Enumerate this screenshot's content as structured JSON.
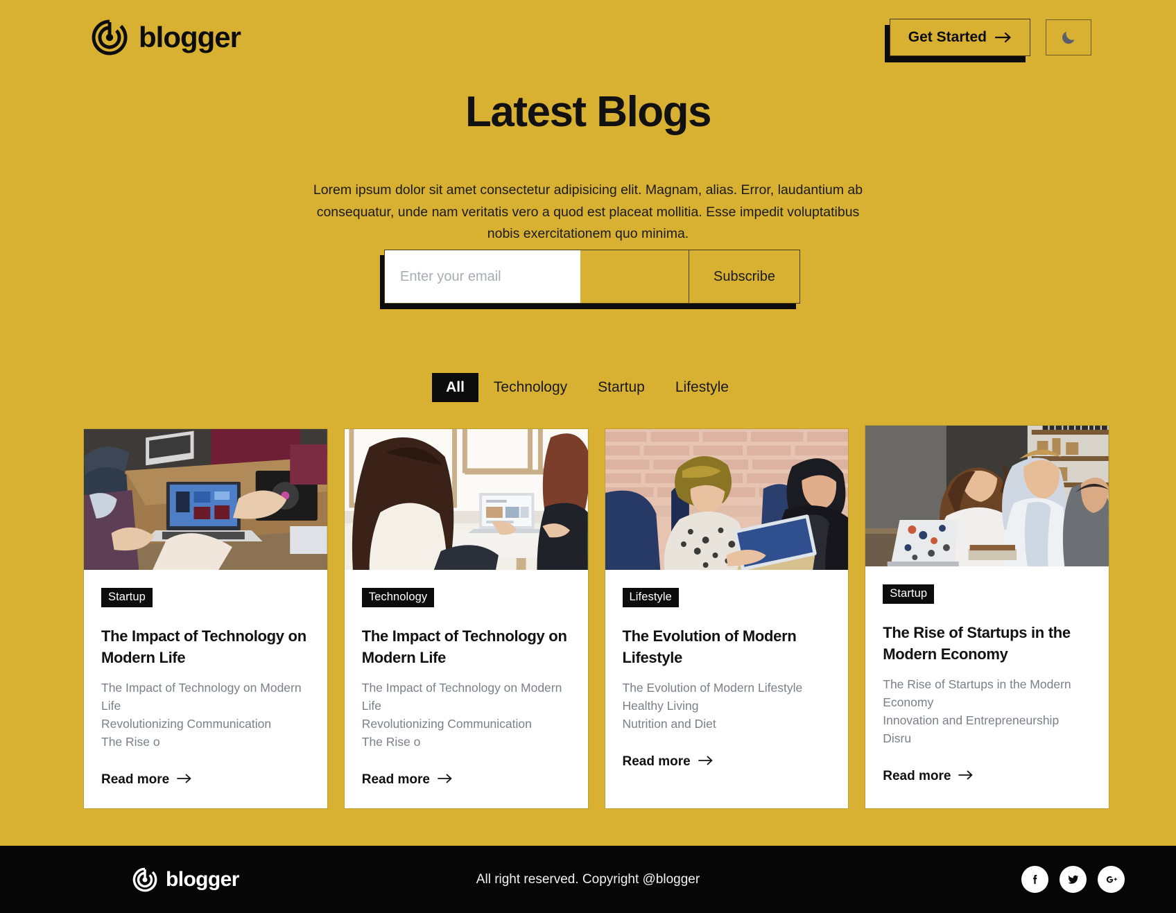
{
  "brand": {
    "name": "blogger",
    "logo_icon": "target-power-icon"
  },
  "header": {
    "get_started_label": "Get Started",
    "get_started_icon": "arrow-right-icon",
    "theme_toggle_icon": "moon-icon"
  },
  "hero": {
    "title": "Latest Blogs",
    "subtitle": "Lorem ipsum dolor sit amet consectetur adipisicing elit. Magnam, alias. Error, laudantium ab consequatur, unde nam veritatis vero a quod est placeat mollitia. Esse impedit voluptatibus nobis exercitationem quo minima."
  },
  "subscribe": {
    "email_placeholder": "Enter your email",
    "email_value": "",
    "button_label": "Subscribe"
  },
  "filters": {
    "items": [
      {
        "label": "All",
        "active": true
      },
      {
        "label": "Technology",
        "active": false
      },
      {
        "label": "Startup",
        "active": false
      },
      {
        "label": "Lifestyle",
        "active": false
      }
    ]
  },
  "cards": [
    {
      "badge": "Startup",
      "title": "The Impact of Technology on Modern Life",
      "excerpt": "The Impact of Technology on Modern Life\nRevolutionizing Communication\nThe Rise o",
      "read_more": "Read more",
      "image_alt": "people-at-desk-with-laptops"
    },
    {
      "badge": "Technology",
      "title": "The Impact of Technology on Modern Life",
      "excerpt": "The Impact of Technology on Modern Life\nRevolutionizing Communication\nThe Rise o",
      "read_more": "Read more",
      "image_alt": "two-women-working-on-laptop-by-window"
    },
    {
      "badge": "Lifestyle",
      "title": "The Evolution of Modern Lifestyle",
      "excerpt": "The Evolution of Modern Lifestyle\nHealthy Living\nNutrition and Diet",
      "read_more": "Read more",
      "image_alt": "two-women-talking-brick-wall-office"
    },
    {
      "badge": "Startup",
      "title": "The Rise of Startups in the Modern Economy",
      "excerpt": "The Rise of Startups in the Modern Economy\nInnovation and Entrepreneurship\nDisru",
      "read_more": "Read more",
      "image_alt": "team-meeting-with-laptop-in-library"
    }
  ],
  "footer": {
    "brand": "blogger",
    "copyright": "All right reserved. Copyright @blogger",
    "socials": [
      {
        "name": "facebook-icon"
      },
      {
        "name": "twitter-icon"
      },
      {
        "name": "google-plus-icon"
      }
    ]
  },
  "colors": {
    "background": "#d9b132",
    "accent_dark": "#0c0c0c",
    "card_bg": "#ffffff",
    "muted_text": "#7b7f88",
    "footer_bg": "#060606"
  }
}
